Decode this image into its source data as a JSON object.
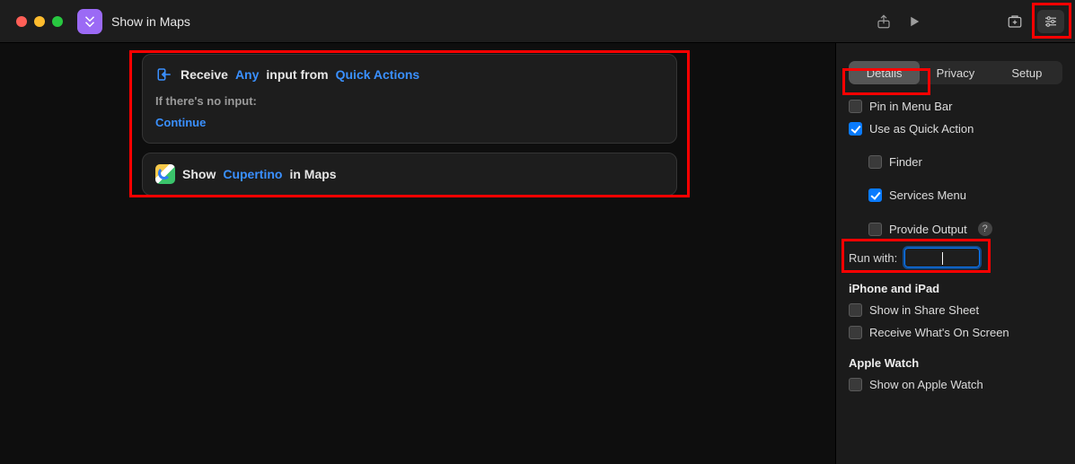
{
  "header": {
    "title": "Show in Maps"
  },
  "workflow": {
    "receive": {
      "prefix": "Receive",
      "type_token": "Any",
      "mid": "input from",
      "source_token": "Quick Actions",
      "no_input_label": "If there's no input:",
      "no_input_action": "Continue"
    },
    "showmaps": {
      "prefix": "Show",
      "location_token": "Cupertino",
      "suffix": "in Maps"
    }
  },
  "sidebar": {
    "tabs": {
      "details": "Details",
      "privacy": "Privacy",
      "setup": "Setup"
    },
    "pin_menubar": "Pin in Menu Bar",
    "use_quick_action": "Use as Quick Action",
    "finder": "Finder",
    "services_menu": "Services Menu",
    "provide_output": "Provide Output",
    "run_with_label": "Run with:",
    "iphone_ipad_header": "iPhone and iPad",
    "share_sheet": "Show in Share Sheet",
    "receive_onscreen": "Receive What's On Screen",
    "apple_watch_header": "Apple Watch",
    "show_apple_watch": "Show on Apple Watch"
  }
}
